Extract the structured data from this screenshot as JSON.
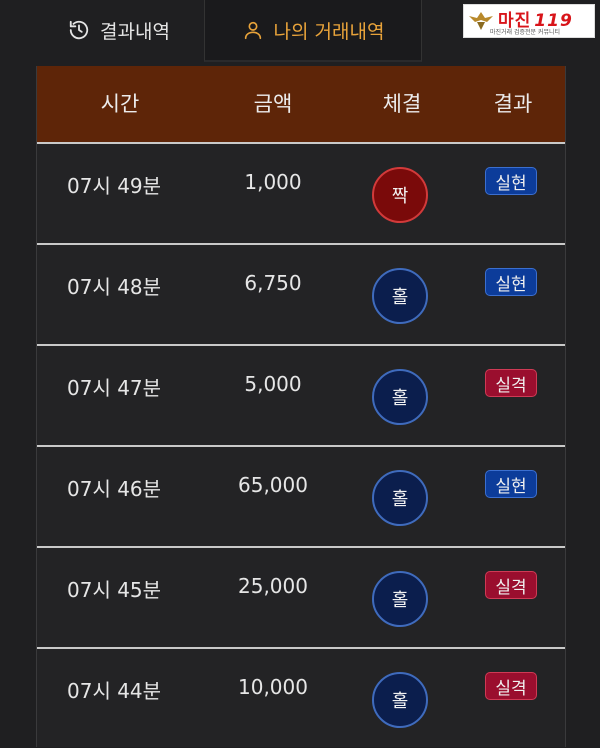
{
  "tabs": {
    "history_label": "결과내역",
    "mine_label": "나의 거래내역"
  },
  "logo": {
    "text": "마진",
    "number": "119",
    "subtitle": "마진거래 검증전문 커뮤니티"
  },
  "table": {
    "headers": [
      "시간",
      "금액",
      "체결",
      "결과"
    ],
    "rows": [
      {
        "time": "07시 49분",
        "amount": "1,000",
        "exec": "짝",
        "result": "실현"
      },
      {
        "time": "07시 48분",
        "amount": "6,750",
        "exec": "홀",
        "result": "실현"
      },
      {
        "time": "07시 47분",
        "amount": "5,000",
        "exec": "홀",
        "result": "실격"
      },
      {
        "time": "07시 46분",
        "amount": "65,000",
        "exec": "홀",
        "result": "실현"
      },
      {
        "time": "07시 45분",
        "amount": "25,000",
        "exec": "홀",
        "result": "실격"
      },
      {
        "time": "07시 44분",
        "amount": "10,000",
        "exec": "홀",
        "result": "실격"
      }
    ]
  },
  "colors": {
    "accent": "#e8a33a",
    "header_bg": "#5e2508",
    "even_ball": "#7a0a0a",
    "odd_ball": "#0b1e4d",
    "win_badge": "#0c3c9a",
    "lose_badge": "#9a0e2e"
  },
  "icons": {
    "history_tab": "history-icon",
    "mine_tab": "user-icon"
  }
}
